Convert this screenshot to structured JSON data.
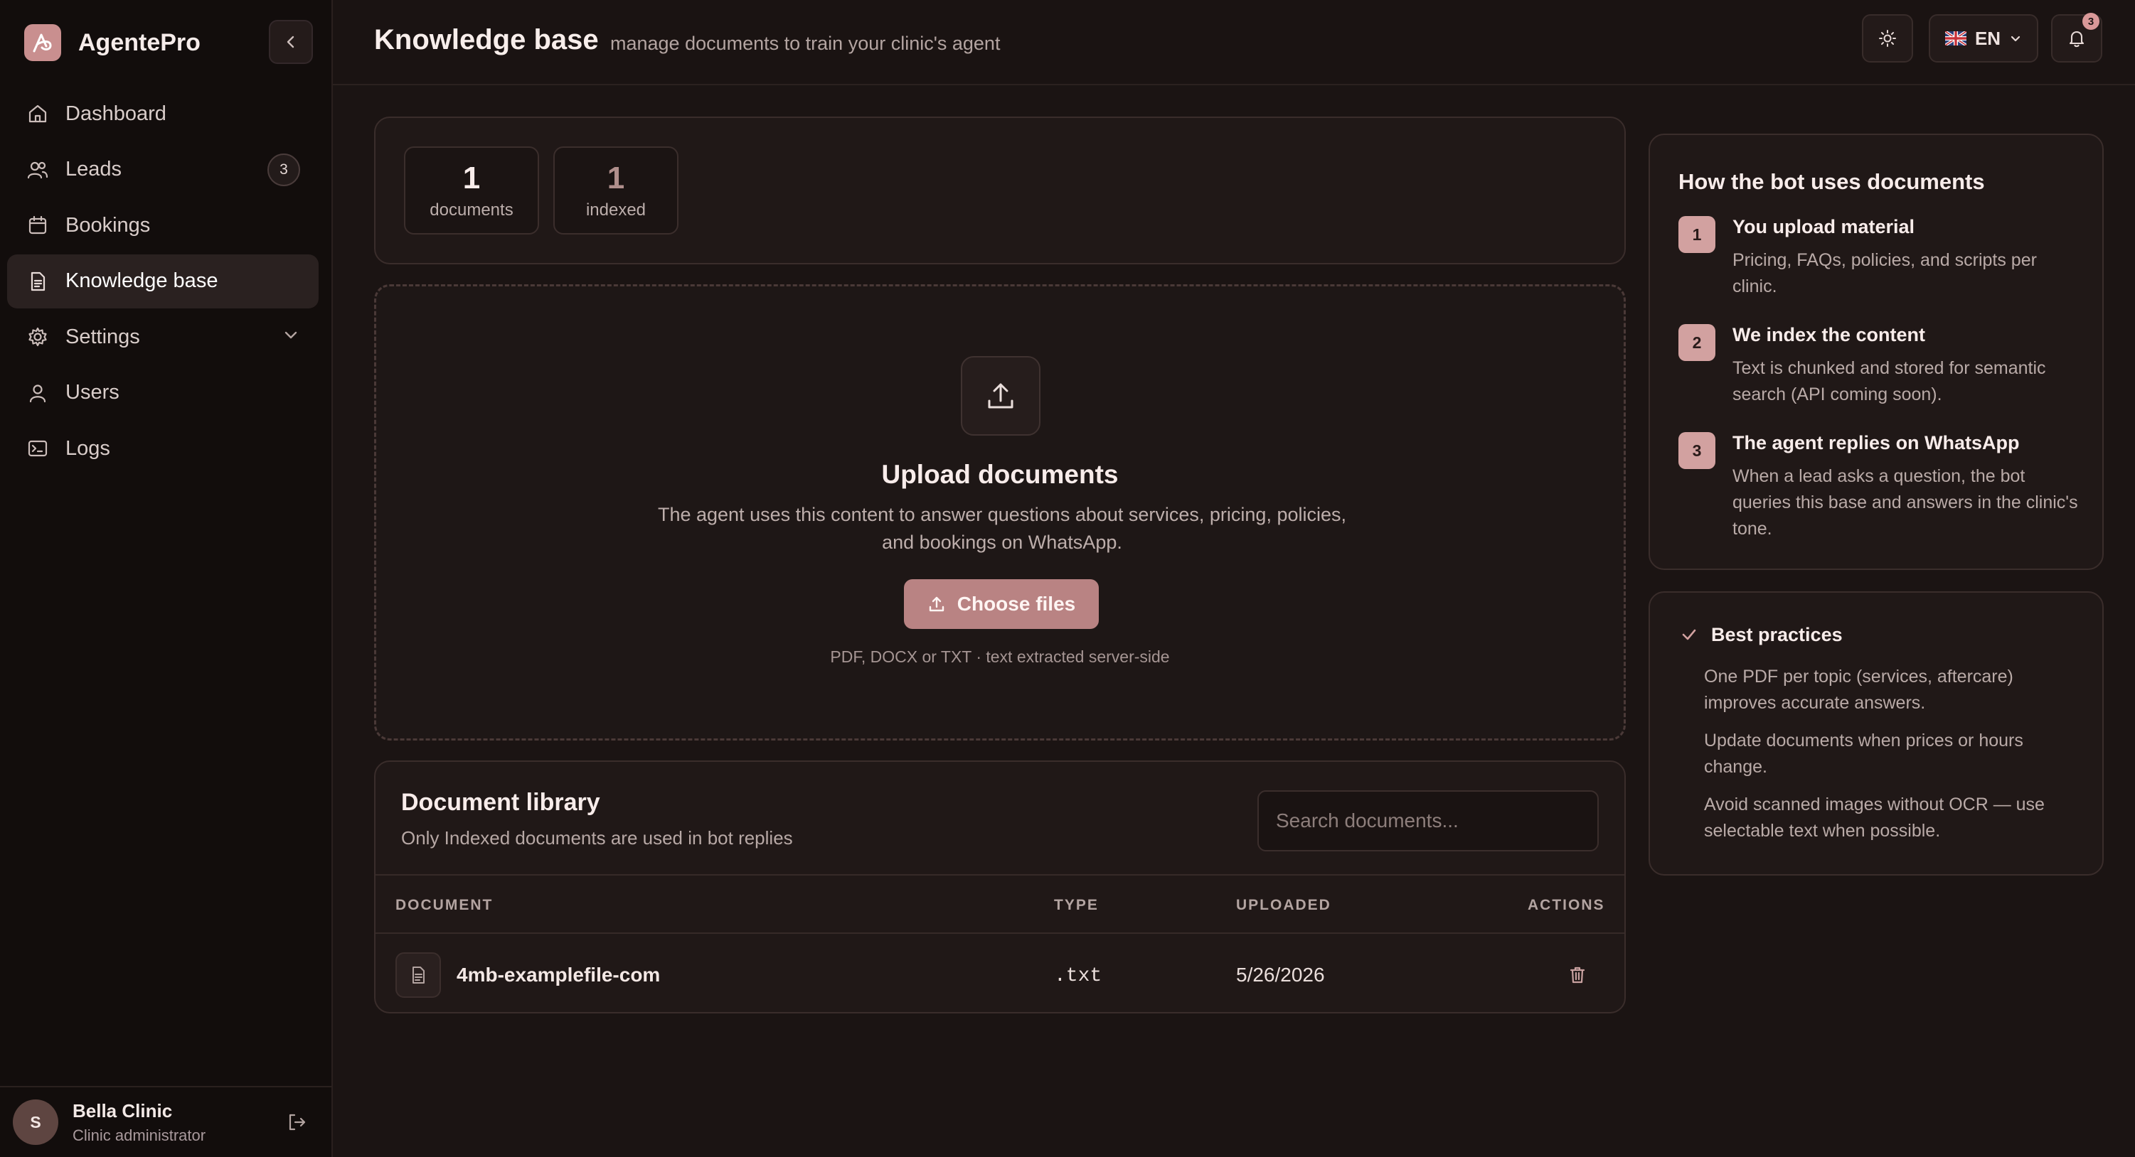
{
  "app": {
    "name": "AgentePro"
  },
  "sidebar": {
    "items": [
      {
        "label": "Dashboard",
        "icon": "home-icon"
      },
      {
        "label": "Leads",
        "icon": "users-icon",
        "badge": "3"
      },
      {
        "label": "Bookings",
        "icon": "calendar-icon"
      },
      {
        "label": "Knowledge base",
        "icon": "document-icon",
        "active": true
      },
      {
        "label": "Settings",
        "icon": "gear-icon",
        "expandable": true
      },
      {
        "label": "Users",
        "icon": "user-icon"
      },
      {
        "label": "Logs",
        "icon": "terminal-icon"
      }
    ]
  },
  "user": {
    "avatar_initial": "S",
    "name": "Bella Clinic",
    "role": "Clinic administrator"
  },
  "header": {
    "title": "Knowledge base",
    "subtitle": "manage documents to train your clinic's agent",
    "language": "EN",
    "notifications_count": "3"
  },
  "stats": [
    {
      "value": "1",
      "label": "documents"
    },
    {
      "value": "1",
      "label": "indexed"
    }
  ],
  "upload": {
    "title": "Upload documents",
    "description": "The agent uses this content to answer questions about services, pricing, policies, and bookings on WhatsApp.",
    "button_label": "Choose files",
    "hint": "PDF, DOCX or TXT · text extracted server-side"
  },
  "library": {
    "title": "Document library",
    "subtitle": "Only Indexed documents are used in bot replies",
    "search_placeholder": "Search documents...",
    "columns": [
      "DOCUMENT",
      "TYPE",
      "UPLOADED",
      "ACTIONS"
    ],
    "rows": [
      {
        "name": "4mb-examplefile-com",
        "type": ".txt",
        "uploaded": "5/26/2026"
      }
    ]
  },
  "how": {
    "title": "How the bot uses documents",
    "steps": [
      {
        "num": "1",
        "title": "You upload material",
        "desc": "Pricing, FAQs, policies, and scripts per clinic."
      },
      {
        "num": "2",
        "title": "We index the content",
        "desc": "Text is chunked and stored for semantic search (API coming soon)."
      },
      {
        "num": "3",
        "title": "The agent replies on WhatsApp",
        "desc": "When a lead asks a question, the bot queries this base and answers in the clinic's tone."
      }
    ]
  },
  "best_practices": {
    "title": "Best practices",
    "tips": [
      "One PDF per topic (services, aftercare) improves accurate answers.",
      "Update documents when prices or hours change.",
      "Avoid scanned images without OCR — use selectable text when possible."
    ]
  },
  "colors": {
    "background": "#1b1413",
    "sidebar": "#120d0c",
    "card": "#201817",
    "accent": "#b98383",
    "step_badge": "#d2a1a0"
  }
}
